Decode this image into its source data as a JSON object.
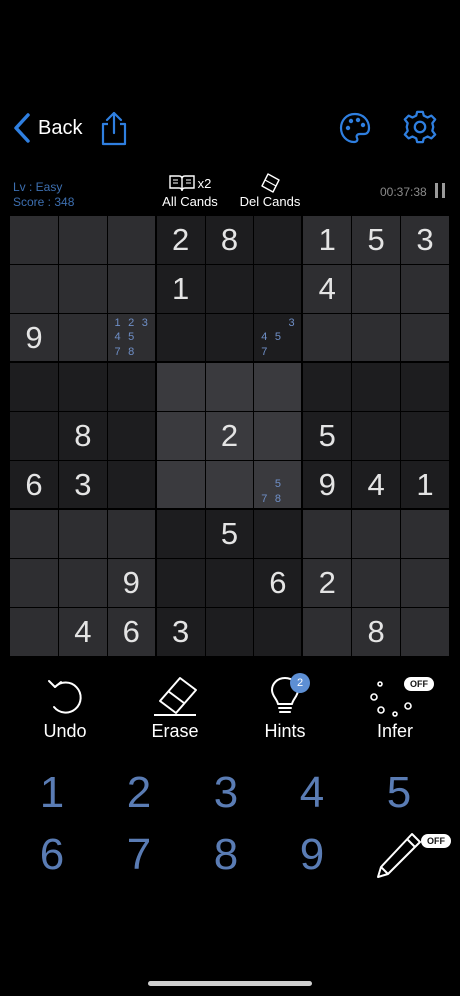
{
  "nav": {
    "back_label": "Back"
  },
  "info": {
    "level": "Lv : Easy",
    "score": "Score : 348"
  },
  "tools": {
    "all_cands_label": "All Cands",
    "all_cands_multiplier": "x2",
    "del_cands_label": "Del Cands"
  },
  "timer": "00:37:38",
  "board": {
    "values": [
      [
        "",
        "",
        "",
        "2",
        "8",
        "",
        "1",
        "5",
        "3"
      ],
      [
        "",
        "",
        "",
        "1",
        "",
        "",
        "4",
        "",
        ""
      ],
      [
        "9",
        "",
        "",
        "",
        "",
        "",
        "",
        "",
        ""
      ],
      [
        "",
        "",
        "",
        "",
        "",
        "",
        "",
        "",
        ""
      ],
      [
        "",
        "8",
        "",
        "",
        "2",
        "",
        "5",
        "",
        ""
      ],
      [
        "6",
        "3",
        "",
        "",
        "",
        "",
        "9",
        "4",
        "1"
      ],
      [
        "",
        "",
        "",
        "",
        "5",
        "",
        "",
        "",
        ""
      ],
      [
        "",
        "",
        "9",
        "",
        "",
        "6",
        "2",
        "",
        ""
      ],
      [
        "",
        "4",
        "6",
        "3",
        "",
        "",
        "",
        "8",
        ""
      ]
    ],
    "candidates": {
      "2-2": [
        "1",
        "2",
        "3",
        "4",
        "5",
        "",
        "7",
        "8",
        ""
      ],
      "2-5": [
        "",
        "",
        "3",
        "4",
        "5",
        "",
        "7",
        "",
        ""
      ],
      "5-5": [
        "",
        "",
        "",
        "",
        "5",
        "",
        "7",
        "8",
        ""
      ]
    },
    "colors": {
      "light": "#2e2e31",
      "dark": "#1d1d1f",
      "highlight": "#3a3a3e"
    }
  },
  "actions": {
    "undo_label": "Undo",
    "erase_label": "Erase",
    "hints_label": "Hints",
    "hints_count": "2",
    "infer_label": "Infer",
    "infer_state": "OFF"
  },
  "numpad": [
    "1",
    "2",
    "3",
    "4",
    "5",
    "6",
    "7",
    "8",
    "9"
  ],
  "pencil_state": "OFF",
  "accent_color": "#2f7fe0"
}
